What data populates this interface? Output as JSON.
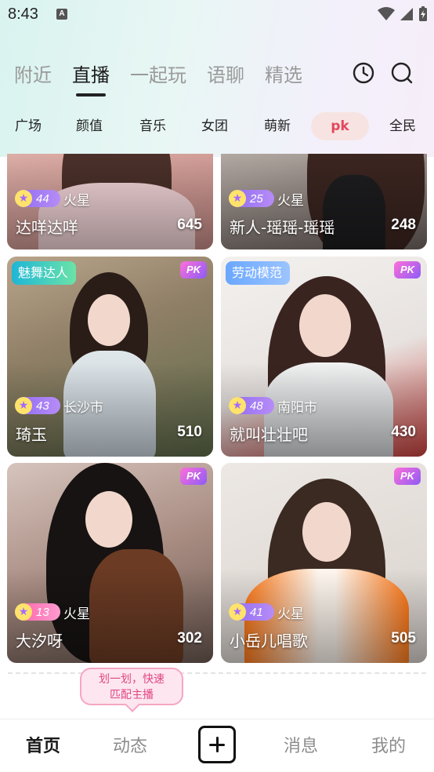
{
  "status_bar": {
    "time": "8:43",
    "notification_icon": "A"
  },
  "top_tabs": [
    {
      "label": "附近",
      "active": false
    },
    {
      "label": "直播",
      "active": true
    },
    {
      "label": "一起玩",
      "active": false
    },
    {
      "label": "语聊",
      "active": false
    },
    {
      "label": "精选",
      "active": false
    }
  ],
  "categories": [
    {
      "label": "广场"
    },
    {
      "label": "颜值"
    },
    {
      "label": "音乐"
    },
    {
      "label": "女团"
    },
    {
      "label": "萌新"
    },
    {
      "label": "pk",
      "active": true
    },
    {
      "label": "全民"
    }
  ],
  "cards": [
    {
      "level": "44",
      "location": "火星",
      "name": "达咩达咩",
      "viewers": "645",
      "pk": false,
      "tag": ""
    },
    {
      "level": "25",
      "location": "火星",
      "name": "新人-瑶瑶-瑶瑶",
      "viewers": "248",
      "pk": false,
      "tag": ""
    },
    {
      "level": "43",
      "location": "长沙市",
      "name": "琦玉",
      "viewers": "510",
      "pk": true,
      "pk_label": "PK",
      "tag": "魅舞达人"
    },
    {
      "level": "48",
      "location": "南阳市",
      "name": "就叫壮壮吧",
      "viewers": "430",
      "pk": true,
      "pk_label": "PK",
      "tag": "劳动模范"
    },
    {
      "level": "13",
      "location": "火星",
      "name": "大汐呀",
      "viewers": "302",
      "pk": true,
      "pk_label": "PK",
      "tag": ""
    },
    {
      "level": "41",
      "location": "火星",
      "name": "小岳儿唱歌",
      "viewers": "505",
      "pk": true,
      "pk_label": "PK",
      "tag": ""
    }
  ],
  "swipe_tip": {
    "line1": "划一划，快速",
    "line2": "匹配主播"
  },
  "bottom_nav": {
    "home": "首页",
    "feed": "动态",
    "messages": "消息",
    "mine": "我的"
  },
  "colors": {
    "accent": "#e4475c",
    "level_badge": "#8e6cf0",
    "pk_gradient": "#ff6fd8"
  }
}
